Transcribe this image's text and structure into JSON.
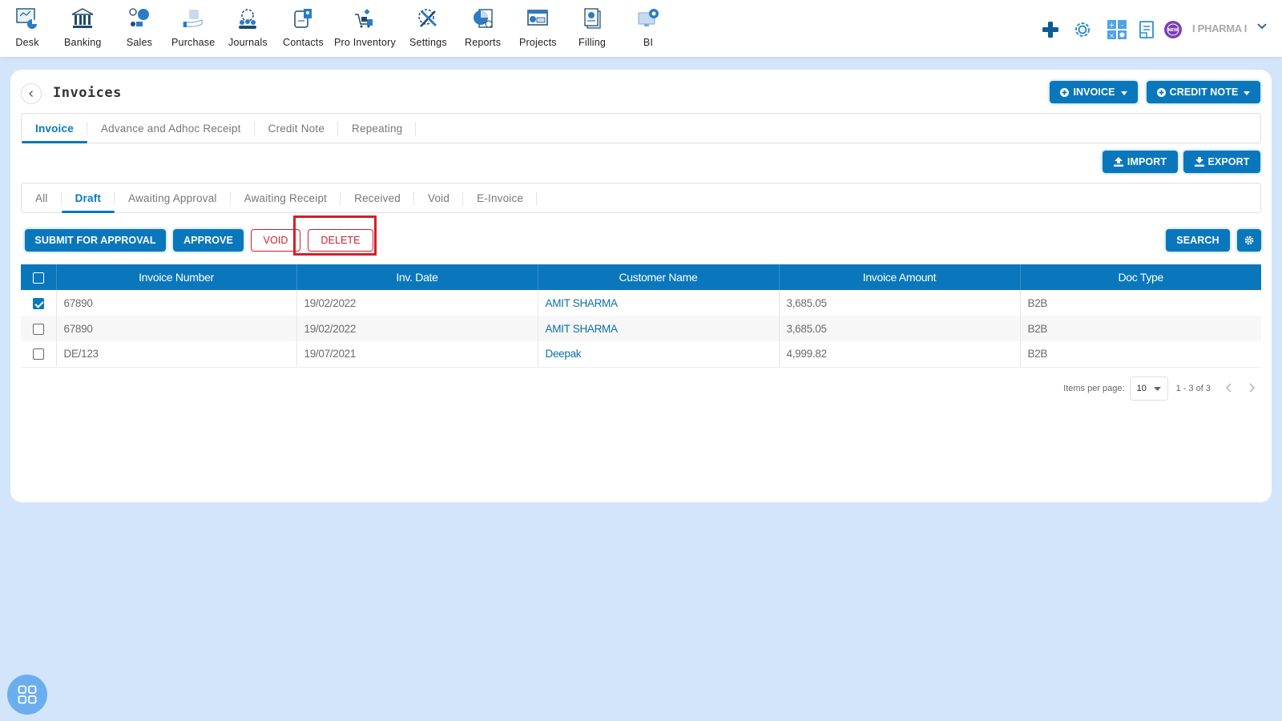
{
  "topnav": {
    "items": [
      {
        "label": "Desk",
        "icon": "desk-icon"
      },
      {
        "label": "Banking",
        "icon": "bank-icon"
      },
      {
        "label": "Sales",
        "icon": "sales-icon"
      },
      {
        "label": "Purchase",
        "icon": "purchase-icon"
      },
      {
        "label": "Journals",
        "icon": "journals-icon"
      },
      {
        "label": "Contacts",
        "icon": "contacts-icon"
      },
      {
        "label": "Pro Inventory",
        "icon": "inventory-icon"
      },
      {
        "label": "Settings",
        "icon": "settings-icon"
      },
      {
        "label": "Reports",
        "icon": "reports-icon"
      },
      {
        "label": "Projects",
        "icon": "projects-icon"
      },
      {
        "label": "Filling",
        "icon": "filling-icon"
      },
      {
        "label": "BI",
        "icon": "bi-icon"
      }
    ],
    "right": {
      "add_icon": "plus-icon",
      "settings_icon": "gear-icon",
      "calculator_icon": "calculator-icon",
      "notes_icon": "clipboard-icon",
      "new_badge_text": "NEW",
      "company_name": "I PHARMA I"
    }
  },
  "page": {
    "title": "Invoices",
    "buttons": {
      "invoice": "INVOICE",
      "credit_note": "CREDIT NOTE",
      "import": "IMPORT",
      "export": "EXPORT",
      "submit_for_approval": "SUBMIT FOR APPROVAL",
      "approve": "APPROVE",
      "void": "VOID",
      "delete": "DELETE",
      "search": "SEARCH"
    },
    "main_tabs": [
      {
        "label": "Invoice",
        "active": true
      },
      {
        "label": "Advance and Adhoc Receipt",
        "active": false
      },
      {
        "label": "Credit Note",
        "active": false
      },
      {
        "label": "Repeating",
        "active": false
      }
    ],
    "status_tabs": [
      {
        "label": "All",
        "active": false
      },
      {
        "label": "Draft",
        "active": true
      },
      {
        "label": "Awaiting Approval",
        "active": false
      },
      {
        "label": "Awaiting Receipt",
        "active": false
      },
      {
        "label": "Received",
        "active": false
      },
      {
        "label": "Void",
        "active": false
      },
      {
        "label": "E-Invoice",
        "active": false
      }
    ]
  },
  "table": {
    "columns": [
      "Invoice Number",
      "Inv. Date",
      "Customer Name",
      "Invoice Amount",
      "Doc Type"
    ],
    "rows": [
      {
        "checked": true,
        "invoice_number": "67890",
        "date": "19/02/2022",
        "customer": "AMIT SHARMA",
        "amount": "3,685.05",
        "doc_type": "B2B"
      },
      {
        "checked": false,
        "invoice_number": "67890",
        "date": "19/02/2022",
        "customer": "AMIT SHARMA",
        "amount": "3,685.05",
        "doc_type": "B2B"
      },
      {
        "checked": false,
        "invoice_number": "DE/123",
        "date": "19/07/2021",
        "customer": "Deepak",
        "amount": "4,999.82",
        "doc_type": "B2B"
      }
    ]
  },
  "pagination": {
    "items_per_page_label": "Items per page:",
    "items_per_page": "10",
    "range": "1 - 3 of 3"
  },
  "colors": {
    "primary": "#0a77bd",
    "danger": "#d0202a",
    "background": "#d3e5fb"
  }
}
